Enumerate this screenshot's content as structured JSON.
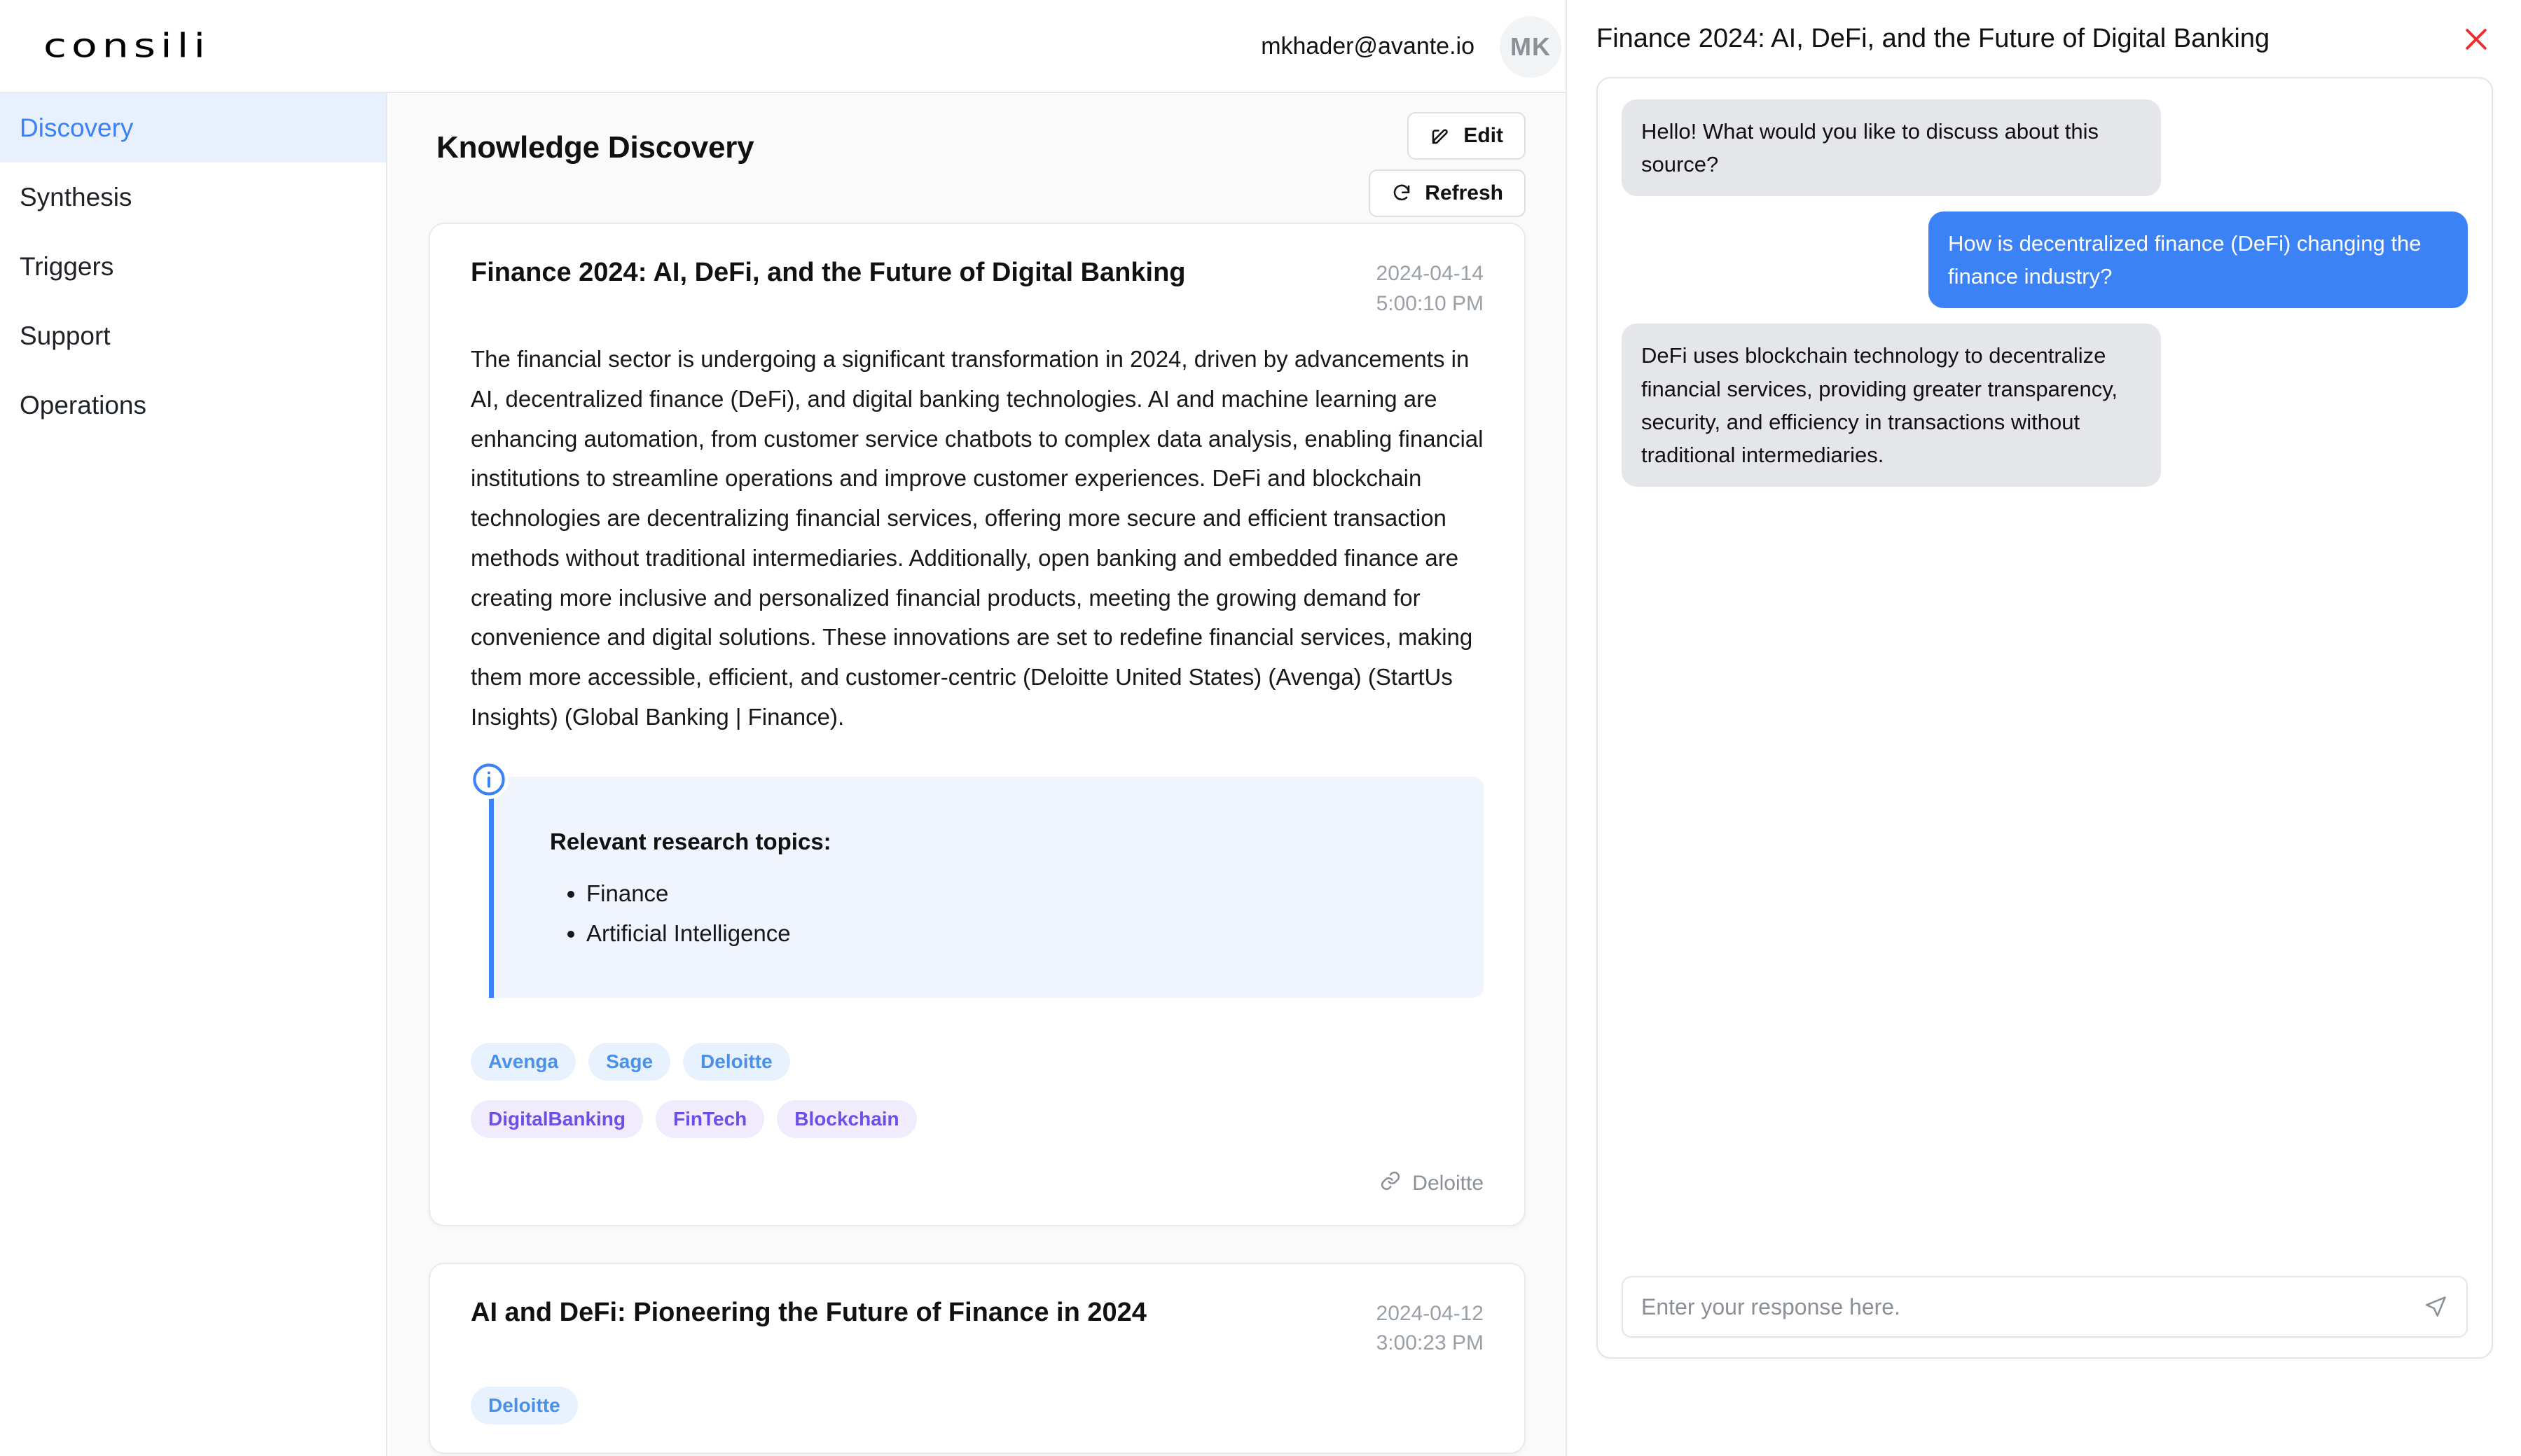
{
  "app": {
    "logo_text": "consili"
  },
  "header": {
    "user_email": "mkhader@avante.io",
    "avatar_initials": "MK"
  },
  "sidebar": {
    "items": [
      {
        "label": "Discovery",
        "active": true
      },
      {
        "label": "Synthesis",
        "active": false
      },
      {
        "label": "Triggers",
        "active": false
      },
      {
        "label": "Support",
        "active": false
      },
      {
        "label": "Operations",
        "active": false
      }
    ]
  },
  "main": {
    "page_title": "Knowledge Discovery",
    "edit_label": "Edit",
    "refresh_label": "Refresh",
    "cards": [
      {
        "title": "Finance 2024: AI, DeFi, and the Future of Digital Banking",
        "date": "2024-04-14",
        "time": "5:00:10 PM",
        "body": "The financial sector is undergoing a significant transformation in 2024, driven by advancements in AI, decentralized finance (DeFi), and digital banking technologies. AI and machine learning are enhancing automation, from customer service chatbots to complex data analysis, enabling financial institutions to streamline operations and improve customer experiences. DeFi and blockchain technologies are decentralizing financial services, offering more secure and efficient transaction methods without traditional intermediaries. Additionally, open banking and embedded finance are creating more inclusive and personalized financial products, meeting the growing demand for convenience and digital solutions. These innovations are set to redefine financial services, making them more accessible, efficient, and customer-centric (Deloitte United States) (Avenga) (StartUs Insights) (Global Banking | Finance).",
        "callout_title": "Relevant research topics:",
        "callout_items": [
          "Finance",
          "Artificial Intelligence"
        ],
        "source_tags": [
          "Avenga",
          "Sage",
          "Deloitte"
        ],
        "topic_tags": [
          "DigitalBanking",
          "FinTech",
          "Blockchain"
        ],
        "source_link": "Deloitte"
      },
      {
        "title": "AI and DeFi: Pioneering the Future of Finance in 2024",
        "date": "2024-04-12",
        "time": "3:00:23 PM",
        "source_tags": [
          "Deloitte"
        ]
      }
    ]
  },
  "chat": {
    "title": "Finance 2024: AI, DeFi, and the Future of Digital Banking",
    "messages": [
      {
        "role": "bot",
        "text": "Hello! What would you like to discuss about this source?"
      },
      {
        "role": "user",
        "text": "How is decentralized finance (DeFi) changing the finance industry?"
      },
      {
        "role": "bot",
        "text": "DeFi uses blockchain technology to decentralize financial services, providing greater transparency, security, and efficiency in transactions without traditional intermediaries."
      }
    ],
    "input_value": "",
    "input_placeholder": "Enter your response here."
  },
  "colors": {
    "accent_blue": "#3b82f6",
    "tag_source_text": "#4a90e8",
    "tag_topic_text": "#6d4ee8",
    "close_red": "#f02d2d",
    "muted": "#9aa0a6"
  }
}
